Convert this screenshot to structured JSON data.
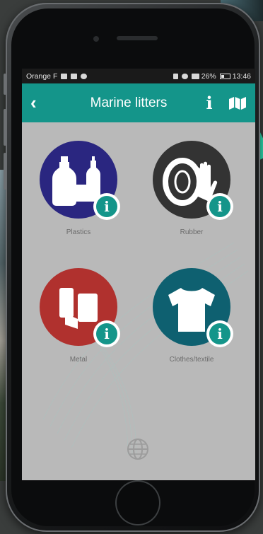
{
  "statusbar": {
    "carrier": "Orange F",
    "battery": "26%",
    "time": "13:46"
  },
  "appbar": {
    "back_icon": "chevron-left-icon",
    "title": "Marine litters",
    "info_icon": "info-icon",
    "map_icon": "map-icon"
  },
  "categories": [
    {
      "label": "Plastics",
      "color": "#2a2680",
      "icon": "plastic-bottles-icon"
    },
    {
      "label": "Rubber",
      "color": "#333333",
      "icon": "tire-glove-icon"
    },
    {
      "label": "Metal",
      "color": "#b0312e",
      "icon": "metal-cans-icon"
    },
    {
      "label": "Clothes/textile",
      "color": "#0e6070",
      "icon": "tshirt-icon"
    }
  ],
  "footer": {
    "icon": "globe-icon"
  },
  "colors": {
    "accent": "#14958a",
    "background": "#b9b9b9"
  }
}
